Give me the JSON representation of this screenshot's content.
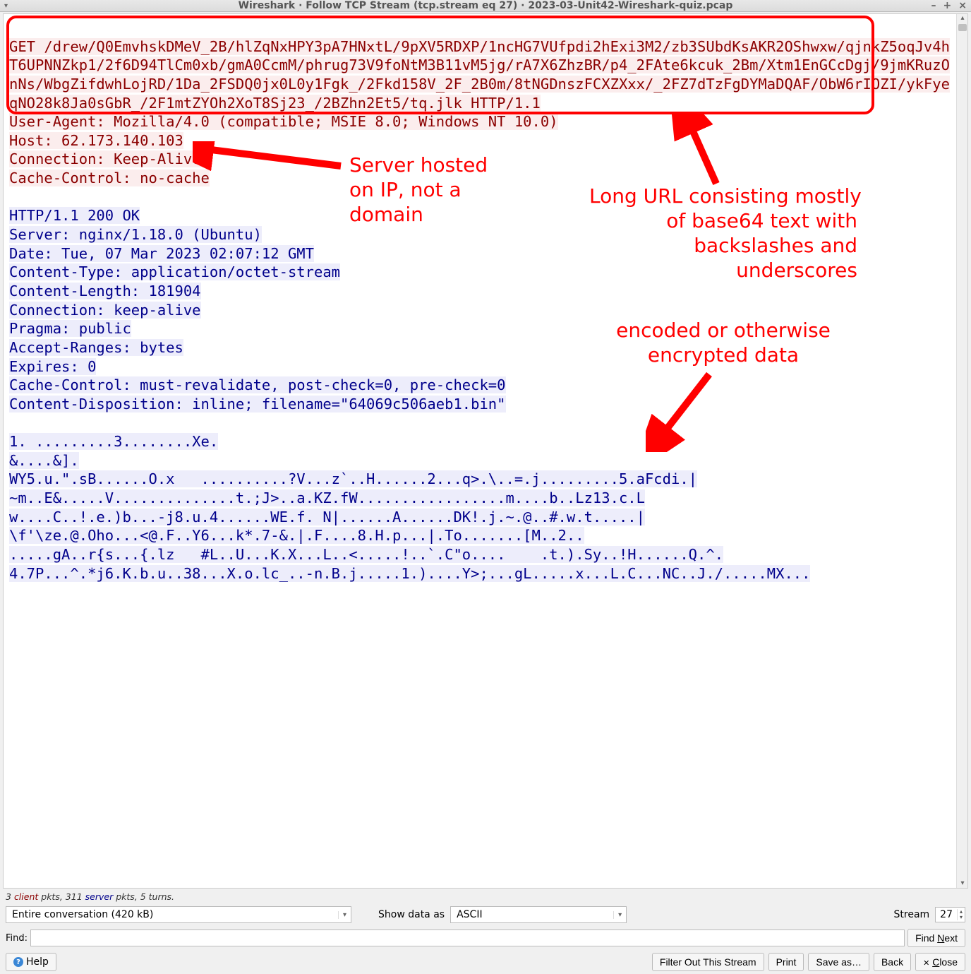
{
  "window": {
    "title": "Wireshark · Follow TCP Stream (tcp.stream eq 27) · 2023-03-Unit42-Wireshark-quiz.pcap"
  },
  "stream": {
    "request_block": "GET /drew/Q0EmvhskDMeV_2B/hlZqNxHPY3pA7HNxtL/9pXV5RDXP/1ncHG7VUfpdi2hExi3M2/zb3SUbdKsAKR2OShwxw/qjnkZ5oqJv4hT6UPNNZkp1/2f6D94TlCm0xb/gmA0CcmM/phrug73V9foNtM3B11vM5jg/rA7X6ZhzBR/p4_2FAte6kcuk_2Bm/Xtm1EnGCcDgj/9jmKRuzOnNs/WbgZifdwhLojRD/1Da_2FSDQ0jx0L0y1Fgk_/2Fkd158V_2F_2B0m/8tNGDnszFCXZXxx/_2FZ7dTzFgDYMaDQAF/ObW6rIOZI/ykFyeqNO28k8Ja0sGbR_/2F1mtZYOh2XoT8Sj23_/2BZhn2Et5/tq.jlk HTTP/1.1",
    "request_headers": "User-Agent: Mozilla/4.0 (compatible; MSIE 8.0; Windows NT 10.0)\nHost: 62.173.140.103\nConnection: Keep-Alive\nCache-Control: no-cache",
    "response_headers": "HTTP/1.1 200 OK\nServer: nginx/1.18.0 (Ubuntu)\nDate: Tue, 07 Mar 2023 02:07:12 GMT\nContent-Type: application/octet-stream\nContent-Length: 181904\nConnection: keep-alive\nPragma: public\nAccept-Ranges: bytes\nExpires: 0\nCache-Control: must-revalidate, post-check=0, pre-check=0\nContent-Disposition: inline; filename=\"64069c506aeb1.bin\"",
    "response_body": "1. .........3........Xe.\n&....&].\nWY5.u.\".sB......O.x   ..........?V...z`..H......2...q>.\\..=.j.........5.aFcdi.|\n~m..E&.....V..............t.;J>..a.KZ.fW.................m....b..Lz13.c.L\nw....C..!.e.)b...-j8.u.4......WE.f. N|......A......DK!.j.~.@..#.w.t.....|\n\\f'\\ze.@.Oho...<@.F..Y6...k*.7-&.|.F....8.H.p...|.To.......[M..2..\n.....gA..r{s...{.lz   #L..U...K.X...L..<.....!..`.C\"o....    .t.).Sy..!H......Q.^.\n4.7P...^.*j6.K.b.u..38...X.o.lc_..-n.B.j.....1.)....Y>;...gL.....x...L.C...NC..J./.....MX..."
  },
  "annotations": {
    "a1": "Server hosted\non IP, not a\ndomain",
    "a2": "Long URL consisting mostly\nof base64 text with\nbackslashes and\nunderscores",
    "a3": "encoded or otherwise\nencrypted data"
  },
  "status": {
    "client_pkts": "3",
    "client_label": "client",
    "mid": " pkts, ",
    "server_pkts": "311",
    "server_label": "server",
    "tail": " pkts, 5 turns."
  },
  "controls": {
    "conversation": "Entire conversation (420 kB)",
    "show_as_label": "Show data as",
    "show_as_value": "ASCII",
    "stream_label": "Stream",
    "stream_value": "27"
  },
  "find": {
    "label": "Find:",
    "button": "Find Next"
  },
  "buttons": {
    "help": "Help",
    "filter_out": "Filter Out This Stream",
    "print": "Print",
    "save_as": "Save as…",
    "back": "Back",
    "close": "Close"
  }
}
